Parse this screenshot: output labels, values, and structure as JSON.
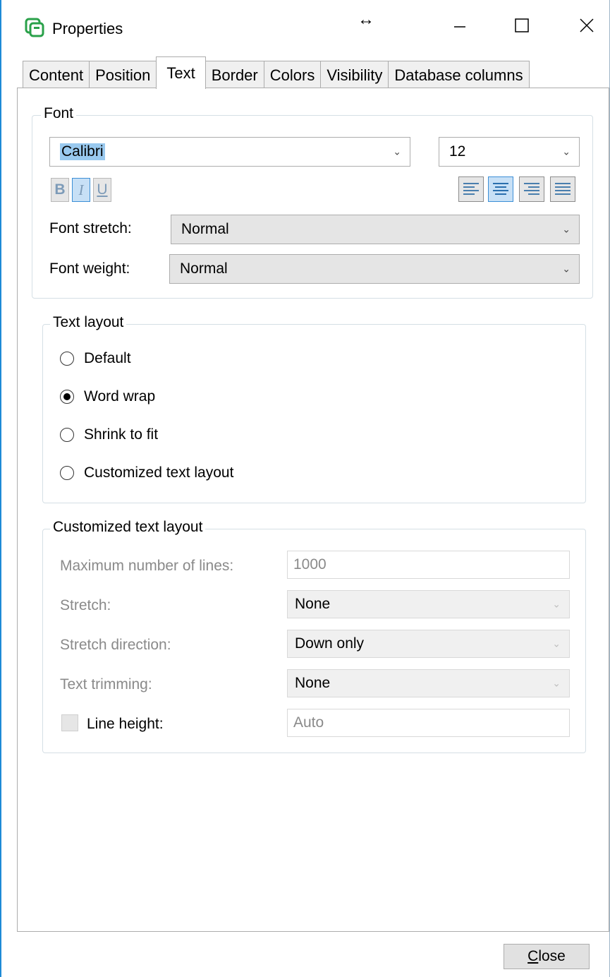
{
  "window": {
    "title": "Properties",
    "icons": {
      "app": "app-logo-icon",
      "resize": "resize-horizontal-icon",
      "minimize": "minimize-icon",
      "maximize": "maximize-icon",
      "close": "close-icon"
    },
    "resize_glyph": "↔"
  },
  "tabs": [
    {
      "label": "Content"
    },
    {
      "label": "Position"
    },
    {
      "label": "Text",
      "active": true
    },
    {
      "label": "Border"
    },
    {
      "label": "Colors"
    },
    {
      "label": "Visibility"
    },
    {
      "label": "Database columns"
    }
  ],
  "font_group": {
    "legend": "Font",
    "family": {
      "value": "Calibri"
    },
    "size": {
      "value": "12"
    },
    "format_buttons": {
      "bold": "B",
      "italic": "I",
      "underline": "U"
    },
    "format_state": {
      "bold": false,
      "italic": true,
      "underline": false
    },
    "alignment": {
      "selected": "center",
      "options": [
        "left",
        "center",
        "right",
        "justify"
      ]
    },
    "stretch": {
      "label": "Font stretch:",
      "value": "Normal"
    },
    "weight": {
      "label": "Font weight:",
      "value": "Normal"
    }
  },
  "layout_group": {
    "legend": "Text layout",
    "options": [
      {
        "label": "Default",
        "checked": false
      },
      {
        "label": "Word wrap",
        "checked": true
      },
      {
        "label": "Shrink to fit",
        "checked": false
      },
      {
        "label": "Customized text layout",
        "checked": false
      }
    ]
  },
  "custom_group": {
    "legend": "Customized text layout",
    "max_lines": {
      "label": "Maximum number of lines:",
      "value": "1000"
    },
    "stretch": {
      "label": "Stretch:",
      "value": "None"
    },
    "stretch_direction": {
      "label": "Stretch direction:",
      "value": "Down only"
    },
    "trimming": {
      "label": "Text trimming:",
      "value": "None"
    },
    "line_height": {
      "label": "Line height:",
      "value": "Auto",
      "checked": false
    }
  },
  "footer": {
    "close_label": "Close",
    "close_accel": "C",
    "close_rest": "lose"
  },
  "colors": {
    "accent": "#1e8ad6",
    "selection": "#99c9ef",
    "toggle_on": "#c7e0f6",
    "app_icon": "#2aa14a"
  }
}
